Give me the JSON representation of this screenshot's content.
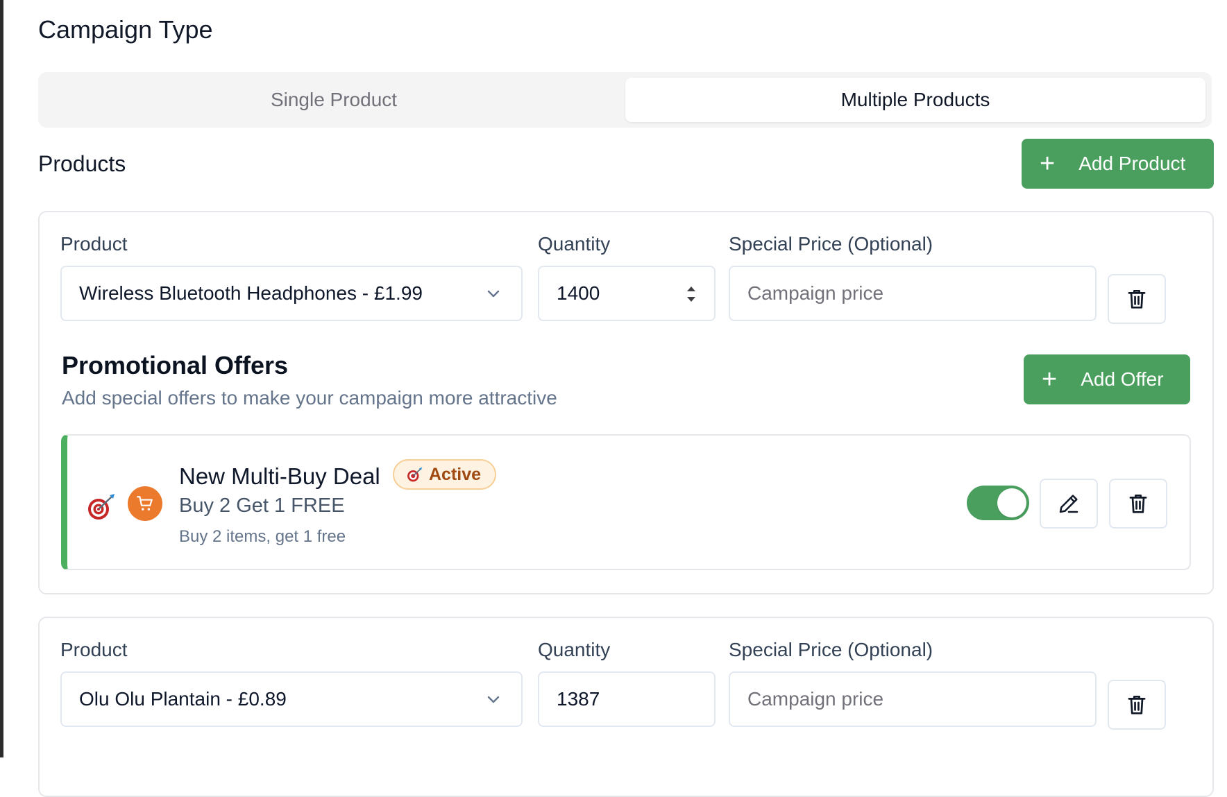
{
  "campaign": {
    "title": "Campaign Type",
    "tabs": [
      {
        "label": "Single Product",
        "active": false
      },
      {
        "label": "Multiple Products",
        "active": true
      }
    ]
  },
  "products_section": {
    "title": "Products",
    "add_button_label": "Add Product"
  },
  "products": [
    {
      "product_label": "Product",
      "product_value": "Wireless Bluetooth Headphones - £1.99",
      "quantity_label": "Quantity",
      "quantity_value": "1400",
      "price_label": "Special Price (Optional)",
      "price_placeholder": "Campaign price"
    },
    {
      "product_label": "Product",
      "product_value": "Olu Olu Plantain - £0.89",
      "quantity_label": "Quantity",
      "quantity_value": "1387",
      "price_label": "Special Price (Optional)",
      "price_placeholder": "Campaign price"
    }
  ],
  "promotions": {
    "title": "Promotional Offers",
    "subtitle": "Add special offers to make your campaign more attractive",
    "add_button_label": "Add Offer",
    "offers": [
      {
        "name": "New Multi-Buy Deal",
        "badge": "Active",
        "headline": "Buy 2 Get 1 FREE",
        "description": "Buy 2 items, get 1 free",
        "enabled": true
      }
    ]
  },
  "colors": {
    "accent_green": "#4a9f5f",
    "offer_border": "#4cae5f",
    "cart_orange": "#ec7a2d",
    "badge_bg": "#fef3e2",
    "badge_text": "#a04a12"
  },
  "icons": [
    "plus-icon",
    "chevron-down-icon",
    "number-spinner-icon",
    "trash-icon",
    "pencil-icon",
    "dart-target-icon",
    "shopping-cart-icon"
  ]
}
